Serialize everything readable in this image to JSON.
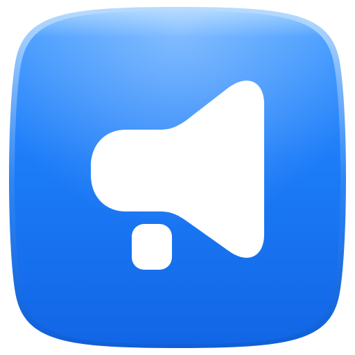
{
  "icon": {
    "name": "megaphone-icon",
    "colors": {
      "tile_top": "#8ec8ff",
      "tile_upper": "#3f98ff",
      "tile_main": "#1c7cf8",
      "tile_bottom": "#1266e6",
      "rim_light": "#b9dcff",
      "rim_dark": "#0f5fd6",
      "glyph": "#ffffff"
    }
  }
}
